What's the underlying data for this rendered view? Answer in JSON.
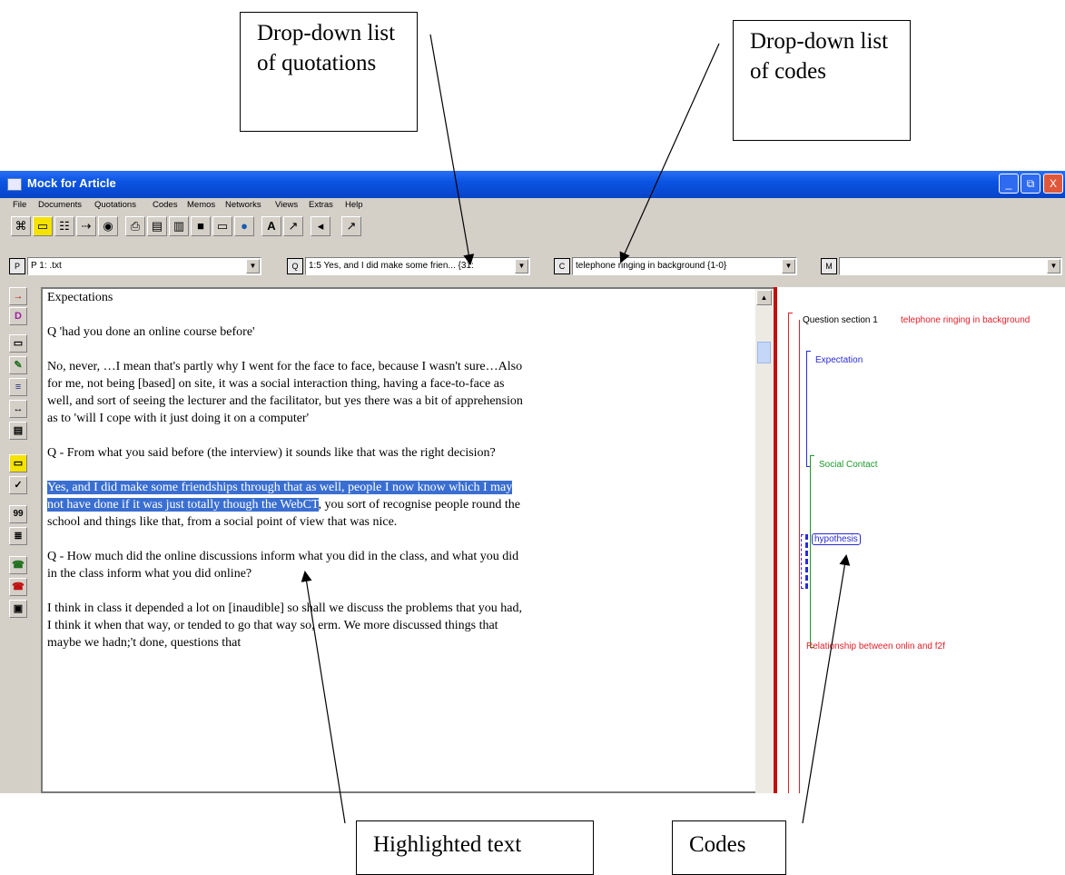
{
  "callouts": {
    "quotations": "Drop-down list of quotations",
    "codes": "Drop-down list of codes",
    "highlighted": "Highlighted text",
    "codes_margin": "Codes"
  },
  "window": {
    "title": "Mock for Article",
    "controls": [
      "_",
      "⧉",
      "X"
    ]
  },
  "menu": [
    "File",
    "Documents",
    "Quotations",
    "Codes",
    "Memos",
    "Networks",
    "Views",
    "Extras",
    "Help"
  ],
  "toolbar_icons": [
    "network-icon",
    "primary-doc-icon",
    "quotation-icon",
    "code-tree-icon",
    "binoculars-icon",
    "print-icon",
    "form-icon",
    "open-icon",
    "save-icon",
    "window-icon",
    "globe-icon",
    "font-icon",
    "arrow-icon",
    "back-icon",
    "pointer-icon"
  ],
  "selectors": {
    "documents_value": "P 1:                    .txt",
    "documents_icon": "P",
    "quotations_value": "1:5 Yes, and I did make some frien... {31:",
    "quotations_icon": "Q",
    "codes_value": "telephone ringing in background {1-0}",
    "codes_icon": "C",
    "memos_value": "",
    "memos_icon": "M",
    "arrow": "▼"
  },
  "sidebar_icons": [
    {
      "name": "open-coding-icon",
      "glyph": "→"
    },
    {
      "name": "code-in-vivo-icon",
      "glyph": "D"
    },
    {
      "name": "create-quotation-icon",
      "glyph": "▭"
    },
    {
      "name": "code-by-list-icon",
      "glyph": "✎"
    },
    {
      "name": "auto-code-icon",
      "glyph": "≡"
    },
    {
      "name": "code-network-icon",
      "glyph": "↔"
    },
    {
      "name": "memo-icon",
      "glyph": "▤"
    },
    {
      "name": "mark-quotation-icon",
      "glyph": "▭"
    },
    {
      "name": "check-icon",
      "glyph": "✓"
    },
    {
      "name": "quote-number-icon",
      "glyph": "99"
    },
    {
      "name": "word-count-icon",
      "glyph": "≣"
    },
    {
      "name": "link-icon",
      "glyph": "☎"
    },
    {
      "name": "unlink-icon",
      "glyph": "☎"
    },
    {
      "name": "view-icon",
      "glyph": "▣"
    }
  ],
  "document": {
    "p1": "Expectations",
    "p2": "Q 'had you done an online course before'",
    "p3": "No, never, …I mean that's partly why I went for the face to face, because I wasn't sure…Also for me, not being [based] on site, it was a social interaction thing, having a face-to-face as well, and sort of seeing the lecturer and the facilitator, but yes there was a bit of apprehension as to 'will I cope with it just doing it on a computer'",
    "p4": "Q - From what you said before (the interview) it sounds like that was the right decision?",
    "p5_highlight": "Yes, and I did make some friendships through that as well, people I now know which I may not have done if it was just totally though the WebCT",
    "p5_rest": ", you sort of recognise people round the school and things like that, from a social point of view that was nice.",
    "p6": "Q - How much did the online discussions inform what you did in the class, and what you did in the class inform what you did online?",
    "p7": "I think in class it depended a lot on [inaudible] so shall we discuss the problems that you had, I think it when that way, or tended to go that way so, erm. We more discussed things that maybe we hadn;'t done, questions that"
  },
  "codes_margin": {
    "question_section": "Question section 1",
    "telephone": "telephone ringing in background",
    "expectation": "Expectation",
    "social_contact": "Social Contact",
    "hypothesis": "hypothesis",
    "relationship": "Relationship between onlin and f2f"
  },
  "colors": {
    "code_red": "#e0202a",
    "code_blue": "#2a2ad8",
    "code_green": "#1a9a2a",
    "highlight": "#3a6fd1",
    "titlebar": "#0a54e3"
  }
}
